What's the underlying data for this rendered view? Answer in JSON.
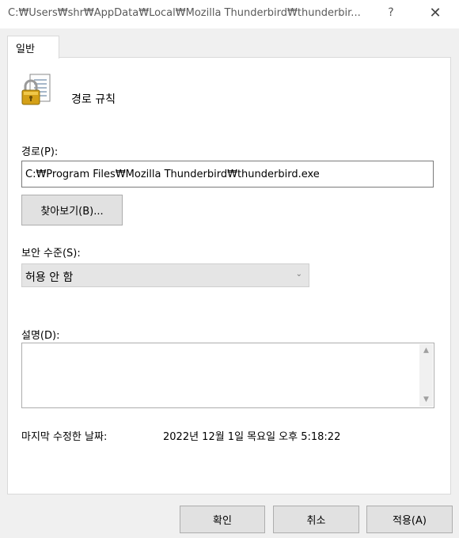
{
  "window": {
    "title": "C:₩Users₩shr₩AppData₩Local₩Mozilla Thunderbird₩thunderbir...",
    "help_glyph": "?",
    "close_glyph": "✕"
  },
  "tabs": [
    {
      "label": "일반"
    }
  ],
  "rule": {
    "title": "경로 규칙",
    "icon": "lock-document-icon"
  },
  "path": {
    "label": "경로(P):",
    "value": "C:₩Program Files₩Mozilla Thunderbird₩thunderbird.exe"
  },
  "browse_button": "찾아보기(B)...",
  "security_level": {
    "label": "보안 수준(S):",
    "value": "허용 안 함"
  },
  "description": {
    "label": "설명(D):",
    "value": ""
  },
  "last_modified": {
    "label": "마지막 수정한 날짜:",
    "value": "2022년 12월 1일 목요일  오후 5:18:22"
  },
  "buttons": {
    "ok": "확인",
    "cancel": "취소",
    "apply": "적용(A)"
  },
  "colors": {
    "window_bg": "#f0f0f0",
    "panel_bg": "#ffffff",
    "button_bg": "#e1e1e1",
    "lock_gold": "#d4a017"
  }
}
